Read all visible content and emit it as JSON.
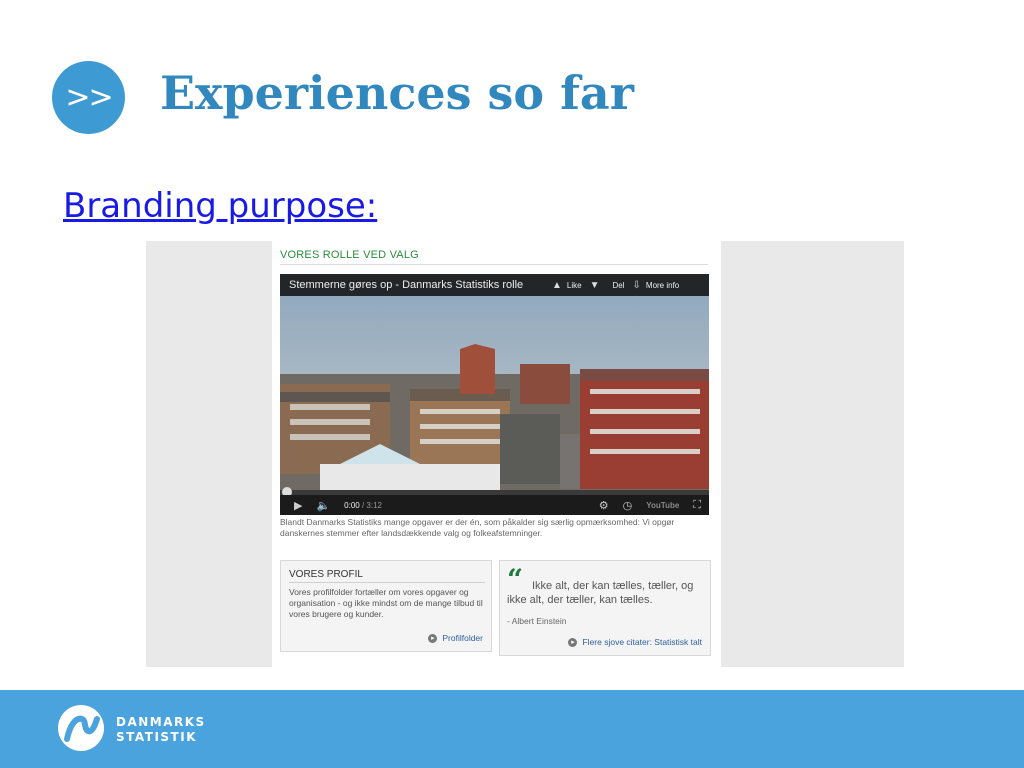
{
  "slide": {
    "bullet_glyph": ">>",
    "title": "Experiences so far",
    "link_text": "Branding purpose:"
  },
  "screenshot": {
    "section_title": "VORES ROLLE VED VALG",
    "video": {
      "title": "Stemmerne gøres op - Danmarks Statistiks rolle",
      "like_label": "Like",
      "share_label": "Del",
      "more_info_label": "More info",
      "current_time": "0:00",
      "duration": "/ 3:12",
      "youtube_label": "YouTube",
      "progress": 0
    },
    "caption": "Blandt Danmarks Statistiks mange opgaver er der én, som påkalder sig særlig opmærksomhed: Vi opgør danskernes stemmer efter landsdækkende valg og folkeafstemninger.",
    "profil_box": {
      "heading": "VORES PROFIL",
      "body": "Vores profilfolder fortæller om vores opgaver og organisation - og ikke mindst om de mange tilbud til vores brugere og kunder.",
      "link": "Profilfolder"
    },
    "quote_box": {
      "quote": "Ikke alt, der kan tælles, tæller, og ikke alt, der tæller, kan tælles.",
      "author": "- Albert Einstein",
      "link": "Flere sjove citater: Statistisk talt"
    }
  },
  "footer": {
    "brand_line1": "DANMARKS",
    "brand_line2": "STATISTIK"
  },
  "colors": {
    "accent": "#3d9ad3",
    "title": "#3188bf",
    "footer": "#4aa3dc",
    "link": "#1a1ae6",
    "green": "#2a8c3d"
  }
}
